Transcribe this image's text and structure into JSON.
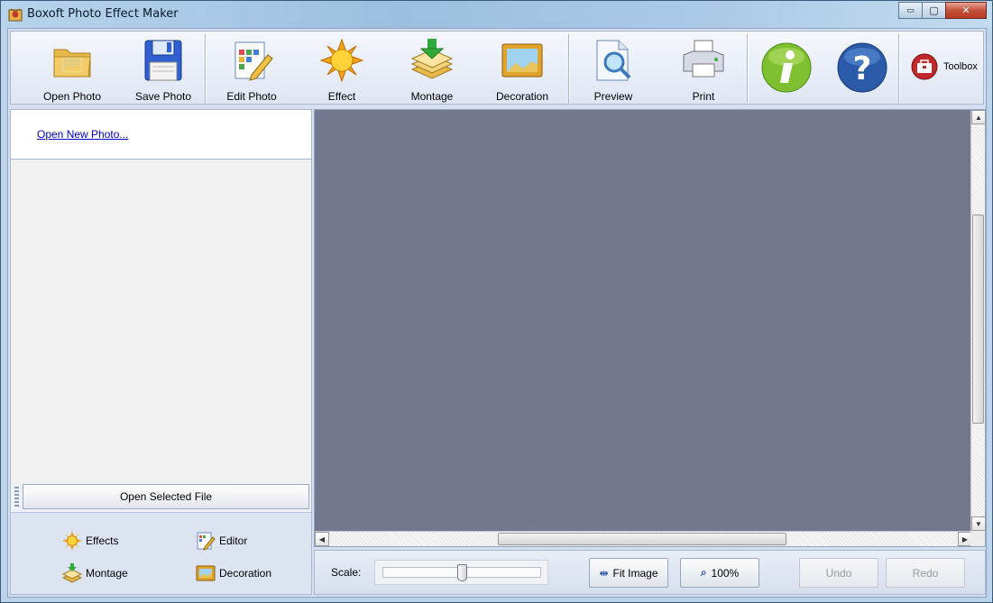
{
  "window": {
    "title": "Boxoft Photo Effect Maker",
    "min_glyph": "▭",
    "max_glyph": "▢",
    "close_glyph": "✕"
  },
  "toolbar": {
    "open_photo": "Open Photo",
    "save_photo": "Save Photo",
    "edit_photo": "Edit Photo",
    "effect": "Effect",
    "montage": "Montage",
    "decoration": "Decoration",
    "preview": "Preview",
    "print": "Print",
    "toolbox": "Toolbox",
    "icons": [
      "folder-icon",
      "floppy-disk-icon",
      "edit-photo-icon",
      "sun-icon",
      "montage-stack-icon",
      "picture-frame-icon",
      "magnifier-page-icon",
      "printer-icon",
      "info-icon",
      "help-icon",
      "toolbox-icon"
    ]
  },
  "left_panel": {
    "open_new_link": "Open New Photo...",
    "open_selected_button": "Open Selected File",
    "modes": {
      "effects": "Effects",
      "editor": "Editor",
      "montage": "Montage",
      "decoration": "Decoration"
    }
  },
  "bottom_bar": {
    "scale_label": "Scale:",
    "scale_value": 0.5,
    "fit_image": "Fit Image",
    "zoom_100": "100%",
    "undo": "Undo",
    "redo": "Redo"
  },
  "colors": {
    "canvas_bg": "#74788f",
    "toolbar_bg": "#eef2f9",
    "link": "#0000cc"
  }
}
